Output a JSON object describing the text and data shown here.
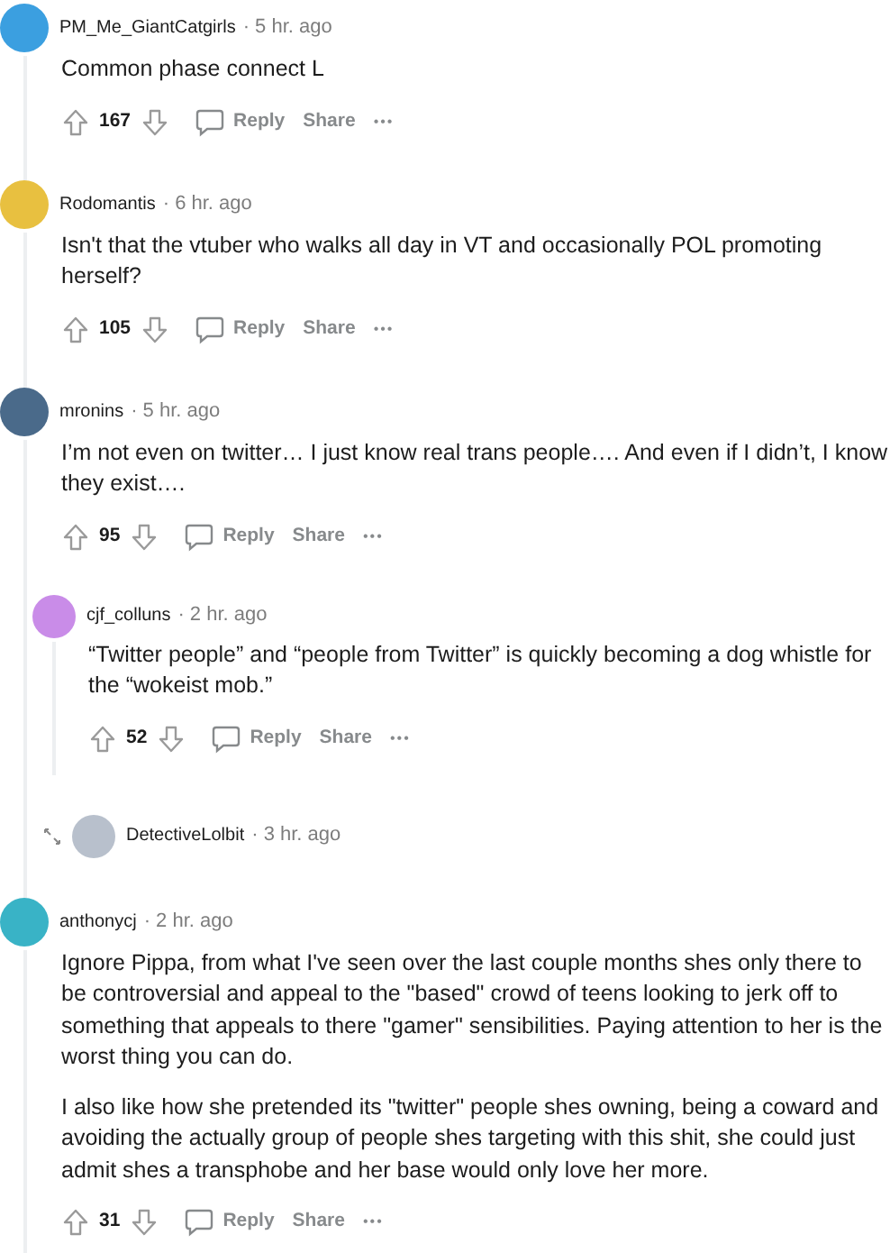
{
  "comments": [
    {
      "kind": "comment",
      "username": "PM_Me_GiantCatgirls",
      "time": "· 5 hr. ago",
      "color": "#3b9fe0",
      "paragraphs": [
        "Common phase connect L"
      ],
      "votes": "167",
      "reply_label": "Reply",
      "share_label": "Share",
      "more_label": "•••"
    },
    {
      "kind": "comment",
      "username": "Rodomantis",
      "time": "· 6 hr. ago",
      "color": "#e8c040",
      "paragraphs": [
        "Isn't that the vtuber who walks all day in VT and occasionally POL promoting herself?"
      ],
      "votes": "105",
      "reply_label": "Reply",
      "share_label": "Share",
      "more_label": "•••"
    },
    {
      "kind": "comment",
      "username": "mronins",
      "time": "· 5 hr. ago",
      "color": "#4a6a8a",
      "paragraphs": [
        "I’m not even on twitter… I just know real trans people…. And even if I didn’t, I know they exist…."
      ],
      "votes": "95",
      "reply_label": "Reply",
      "share_label": "Share",
      "more_label": "•••",
      "children": [
        {
          "kind": "comment",
          "username": "cjf_colluns",
          "time": "· 2 hr. ago",
          "color": "#c98ce8",
          "paragraphs": [
            "“Twitter people” and “people from Twitter” is quickly becoming a dog whistle for the “wokeist mob.”"
          ],
          "votes": "52",
          "reply_label": "Reply",
          "share_label": "Share",
          "more_label": "•••"
        },
        {
          "kind": "collapsed",
          "username": "DetectiveLolbit",
          "time": "· 3 hr. ago",
          "color": "#b8c0cc"
        }
      ]
    },
    {
      "kind": "comment",
      "username": "anthonycj",
      "time": "· 2 hr. ago",
      "color": "#39b3c6",
      "paragraphs": [
        "Ignore Pippa, from what I've seen over the last couple months shes only there to be controversial and appeal to the \"based\" crowd of teens looking to jerk off to something that appeals to there \"gamer\" sensibilities. Paying attention to her is the worst thing you can do.",
        "I also like how she pretended its \"twitter\" people shes owning, being a coward and avoiding the actually group of people shes targeting with this shit, she could just admit shes a transphobe and her base would only love her more."
      ],
      "votes": "31",
      "reply_label": "Reply",
      "share_label": "Share",
      "more_label": "•••"
    }
  ]
}
